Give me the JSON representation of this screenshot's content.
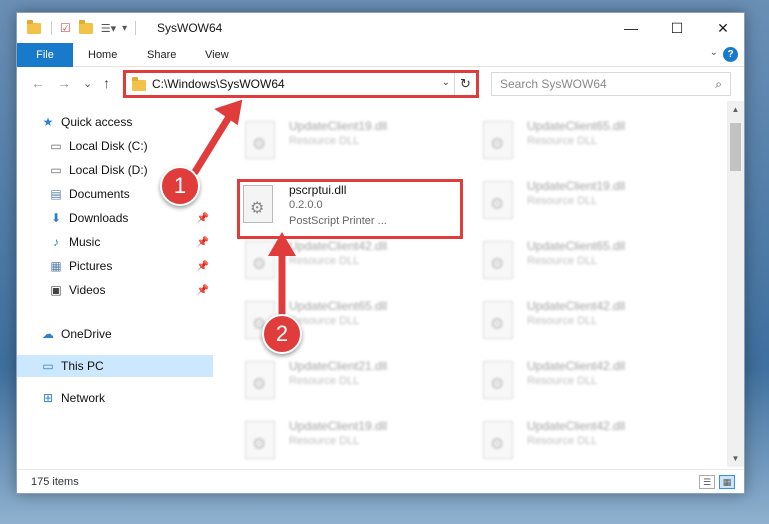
{
  "window": {
    "title": "SysWOW64",
    "minimize_glyph": "—",
    "maximize_glyph": "☐",
    "close_glyph": "✕"
  },
  "ribbon": {
    "tabs": [
      "File",
      "Home",
      "Share",
      "View"
    ],
    "help_glyph": "?",
    "collapse_glyph": "⌄"
  },
  "nav": {
    "back_glyph": "←",
    "forward_glyph": "→",
    "recent_glyph": "⌄",
    "up_glyph": "↑",
    "address": "C:\\Windows\\SysWOW64",
    "address_dropdown_glyph": "⌄",
    "refresh_glyph": "↻",
    "search_placeholder": "Search SysWOW64",
    "search_glyph": "⌕"
  },
  "sidebar": {
    "items": [
      {
        "label": "Quick access",
        "icon": "star-icon"
      },
      {
        "label": "Local Disk (C:)",
        "icon": "drive-icon"
      },
      {
        "label": "Local Disk (D:)",
        "icon": "drive-icon"
      },
      {
        "label": "Documents",
        "icon": "documents-icon"
      },
      {
        "label": "Downloads",
        "icon": "downloads-icon"
      },
      {
        "label": "Music",
        "icon": "music-icon"
      },
      {
        "label": "Pictures",
        "icon": "pictures-icon"
      },
      {
        "label": "Videos",
        "icon": "videos-icon"
      },
      {
        "label": "OneDrive",
        "icon": "cloud-icon"
      },
      {
        "label": "This PC",
        "icon": "monitor-icon"
      },
      {
        "label": "Network",
        "icon": "network-icon"
      }
    ]
  },
  "files": {
    "blurred": [
      {
        "name": "UpdateClient19.dll",
        "desc": "Resource DLL"
      },
      {
        "name": "UpdateClient65.dll",
        "desc": "Resource DLL"
      },
      {
        "name": "UpdateClient19.dll",
        "desc": "Resource DLL"
      },
      {
        "name": "UpdateClient42.dll",
        "desc": "Resource DLL"
      },
      {
        "name": "UpdateClient65.dll",
        "desc": "Resource DLL"
      },
      {
        "name": "UpdateClient65.dll",
        "desc": "Resource DLL"
      },
      {
        "name": "UpdateClient42.dll",
        "desc": "Resource DLL"
      },
      {
        "name": "UpdateClient21.dll",
        "desc": "Resource DLL"
      },
      {
        "name": "UpdateClient42.dll",
        "desc": "Resource DLL"
      },
      {
        "name": "UpdateClient19.dll",
        "desc": "Resource DLL"
      },
      {
        "name": "UpdateClient42.dll",
        "desc": "Resource DLL"
      }
    ],
    "highlighted": {
      "name": "pscrptui.dll",
      "version": "0.2.0.0",
      "desc": "PostScript Printer ..."
    }
  },
  "status": {
    "item_count": "175 items"
  },
  "annotations": {
    "step1": "1",
    "step2": "2",
    "color": "#e03c3c"
  }
}
